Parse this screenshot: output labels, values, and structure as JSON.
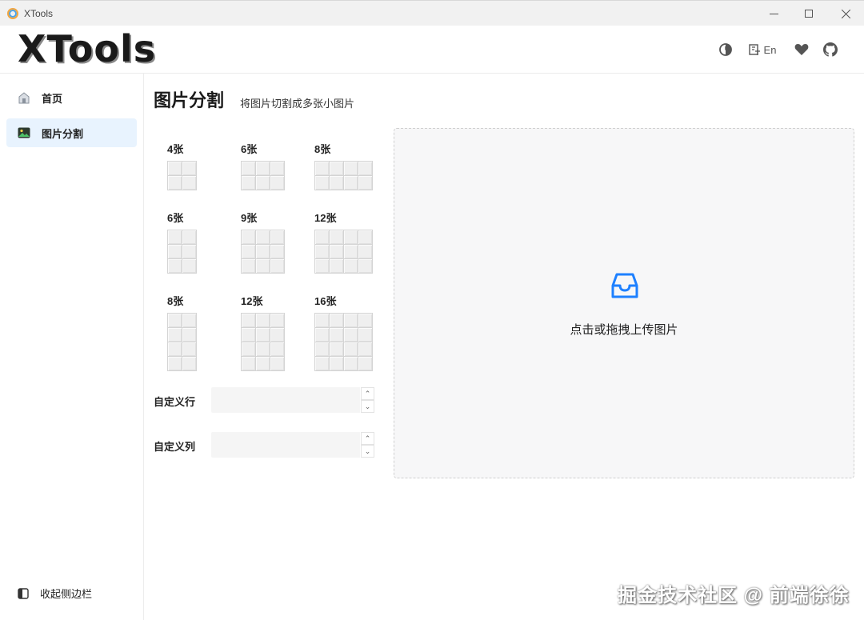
{
  "window": {
    "title": "XTools"
  },
  "header": {
    "logo": "XTools",
    "lang_label": "En"
  },
  "sidebar": {
    "items": [
      {
        "label": "首页",
        "active": false
      },
      {
        "label": "图片分割",
        "active": true
      }
    ],
    "collapse_label": "收起侧边栏"
  },
  "main": {
    "title": "图片分割",
    "subtitle": "将图片切割成多张小图片",
    "presets": [
      {
        "label": "4张",
        "rows": 2,
        "cols": 2
      },
      {
        "label": "6张",
        "rows": 2,
        "cols": 3
      },
      {
        "label": "8张",
        "rows": 2,
        "cols": 4
      },
      {
        "label": "6张",
        "rows": 3,
        "cols": 2
      },
      {
        "label": "9张",
        "rows": 3,
        "cols": 3
      },
      {
        "label": "12张",
        "rows": 3,
        "cols": 4
      },
      {
        "label": "8张",
        "rows": 4,
        "cols": 2
      },
      {
        "label": "12张",
        "rows": 4,
        "cols": 3
      },
      {
        "label": "16张",
        "rows": 4,
        "cols": 4
      }
    ],
    "custom_row_label": "自定义行",
    "custom_col_label": "自定义列",
    "custom_row_value": "",
    "custom_col_value": "",
    "upload_text": "点击或拖拽上传图片"
  },
  "colors": {
    "accent": "#1e80ff",
    "active_bg": "#e8f3fe"
  },
  "watermark": "掘金技术社区 @ 前端徐徐"
}
